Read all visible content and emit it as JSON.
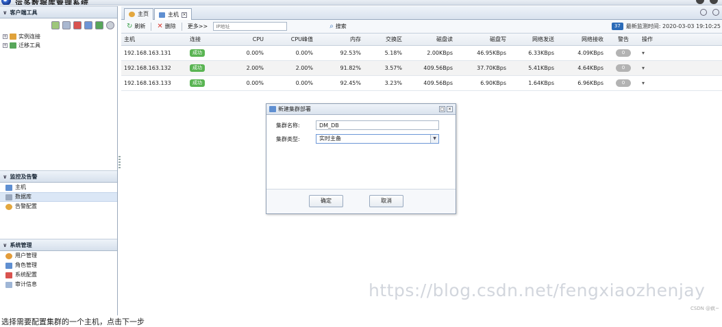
{
  "app": {
    "title": "运多数据库管理系统"
  },
  "sidebar": {
    "client_tools": {
      "title": "客户端工具",
      "items": [
        {
          "label": "实例连接"
        },
        {
          "label": "迁移工具"
        }
      ]
    },
    "monitor": {
      "title": "监控及告警",
      "items": [
        {
          "label": "主机"
        },
        {
          "label": "数据库"
        },
        {
          "label": "告警配置"
        }
      ]
    },
    "system": {
      "title": "系统管理",
      "items": [
        {
          "label": "用户管理"
        },
        {
          "label": "角色管理"
        },
        {
          "label": "系统配置"
        },
        {
          "label": "审计信息"
        }
      ]
    }
  },
  "tabs": [
    {
      "label": "主页"
    },
    {
      "label": "主机"
    }
  ],
  "toolbar": {
    "refresh": "刷新",
    "delete": "删除",
    "more": "更多>>",
    "ip_placeholder": "IP地址",
    "search": "搜索",
    "count": "37",
    "last_check": "最新监测时间: 2020-03-03 19:10:25"
  },
  "table": {
    "columns": [
      "主机",
      "连接",
      "CPU",
      "CPU峰值",
      "内存",
      "交换区",
      "磁盘读",
      "磁盘写",
      "网络发送",
      "网络接收",
      "警告",
      "操作"
    ],
    "rows": [
      {
        "host": "192.168.163.131",
        "conn": "成功",
        "cpu": "0.00%",
        "cpu_peak": "0.00%",
        "mem": "92.53%",
        "swap": "5.18%",
        "disk_read": "2.00KBps",
        "disk_write": "46.95KBps",
        "net_send": "6.33KBps",
        "net_recv": "4.09KBps",
        "warn": "0"
      },
      {
        "host": "192.168.163.132",
        "conn": "成功",
        "cpu": "2.00%",
        "cpu_peak": "2.00%",
        "mem": "91.82%",
        "swap": "3.57%",
        "disk_read": "409.56Bps",
        "disk_write": "37.70KBps",
        "net_send": "5.41KBps",
        "net_recv": "4.64KBps",
        "warn": "0"
      },
      {
        "host": "192.168.163.133",
        "conn": "成功",
        "cpu": "0.00%",
        "cpu_peak": "0.00%",
        "mem": "92.45%",
        "swap": "3.23%",
        "disk_read": "409.56Bps",
        "disk_write": "6.90KBps",
        "net_send": "1.64KBps",
        "net_recv": "6.96KBps",
        "warn": "0"
      }
    ]
  },
  "dialog": {
    "title": "新建集群部署",
    "name_label": "集群名称:",
    "name_value": "DM_DB",
    "type_label": "集群类型:",
    "type_value": "实时主备",
    "ok": "确定",
    "cancel": "取消"
  },
  "watermark": "https://blog.csdn.net/fengxiaozhenjay",
  "csdn_mark": "CSDN @疯~",
  "caption": "选择需要配置集群的一个主机，点击下一步",
  "colors": {
    "success": "#59b452",
    "badge": "#2b6bb8",
    "selected": "#dbe7f6"
  }
}
